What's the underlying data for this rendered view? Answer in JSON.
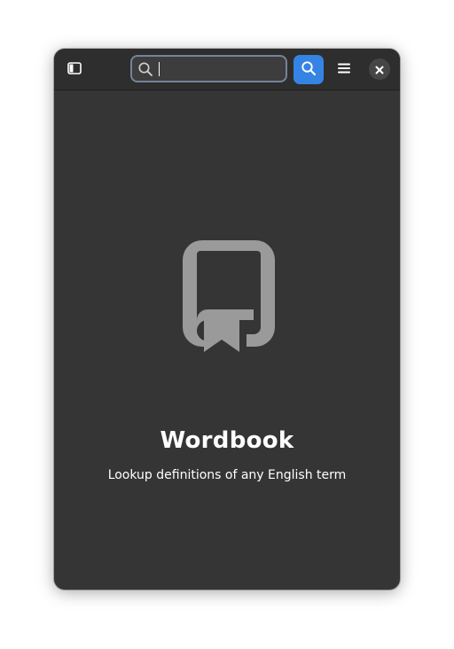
{
  "window": {
    "background": "#353535",
    "headerbar_background": "#2e2e2e"
  },
  "headerbar": {
    "sidebar_icon": "sidebar-show-icon",
    "search": {
      "value": "",
      "placeholder": "",
      "icon": "search-icon",
      "border_color": "#74849a"
    },
    "search_button_icon": "search-icon",
    "search_button_color": "#3584e4",
    "menu_icon": "hamburger-menu-icon",
    "close_icon": "close-icon"
  },
  "status_page": {
    "icon": "wordbook-bookmark-icon",
    "icon_color": "#9a9a9a",
    "title": "Wordbook",
    "description": "Lookup definitions of any English term"
  }
}
